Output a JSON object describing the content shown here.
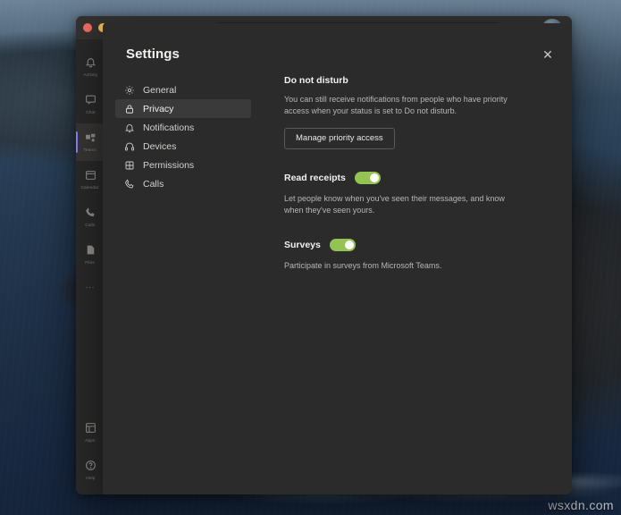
{
  "desktop": {
    "watermark": "wsxdn.com"
  },
  "app_window": {
    "traffic_lights": [
      "close",
      "minimize",
      "zoom"
    ],
    "rail": {
      "items": [
        {
          "label": "Activity",
          "icon": "bell-icon",
          "active": false
        },
        {
          "label": "Chat",
          "icon": "chat-icon",
          "active": false
        },
        {
          "label": "Teams",
          "icon": "teams-icon",
          "active": true
        },
        {
          "label": "Calendar",
          "icon": "calendar-icon",
          "active": false
        },
        {
          "label": "Calls",
          "icon": "phone-icon",
          "active": false
        },
        {
          "label": "Files",
          "icon": "files-icon",
          "active": false
        }
      ],
      "overflow": "...",
      "bottom_items": [
        {
          "label": "Apps",
          "icon": "apps-icon"
        },
        {
          "label": "Help",
          "icon": "help-icon"
        }
      ]
    },
    "more_options": "..."
  },
  "dialog": {
    "title": "Settings",
    "close_label": "✕",
    "nav": {
      "items": [
        {
          "label": "General",
          "icon": "gear-icon",
          "selected": false
        },
        {
          "label": "Privacy",
          "icon": "lock-icon",
          "selected": true
        },
        {
          "label": "Notifications",
          "icon": "bell-icon",
          "selected": false
        },
        {
          "label": "Devices",
          "icon": "headset-icon",
          "selected": false
        },
        {
          "label": "Permissions",
          "icon": "grid-icon",
          "selected": false
        },
        {
          "label": "Calls",
          "icon": "phone-icon",
          "selected": false
        }
      ]
    },
    "panel": {
      "do_not_disturb": {
        "heading": "Do not disturb",
        "description": "You can still receive notifications from people who have priority access when your status is set to Do not disturb.",
        "button_label": "Manage priority access"
      },
      "read_receipts": {
        "label": "Read receipts",
        "toggle_on": true,
        "description": "Let people know when you've seen their messages, and know when they've seen yours."
      },
      "surveys": {
        "label": "Surveys",
        "toggle_on": true,
        "description": "Participate in surveys from Microsoft Teams."
      }
    }
  },
  "colors": {
    "toggle_on": "#92C353",
    "dialog_bg": "#2B2B2B",
    "accent": "#7B83EB",
    "selected_row": "#3B3A3A"
  }
}
